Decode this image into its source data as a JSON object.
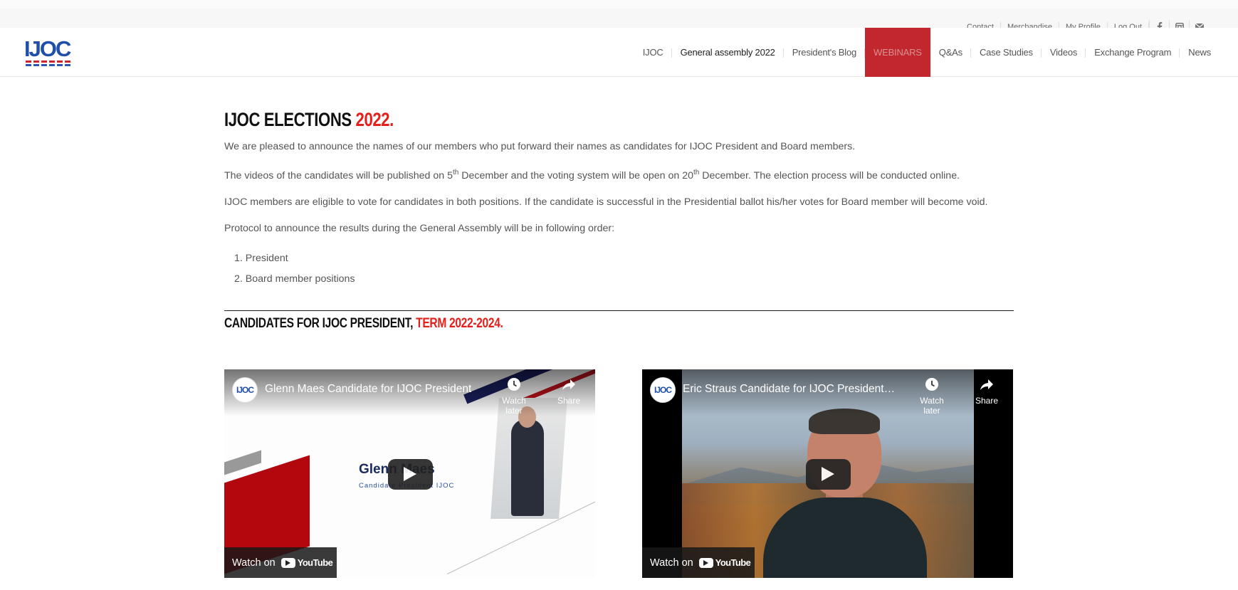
{
  "topbar": {
    "links": [
      "Contact",
      "Merchandise",
      "My Profile",
      "Log Out"
    ],
    "social_icons": [
      "facebook-icon",
      "instagram-icon",
      "mail-icon"
    ]
  },
  "header": {
    "logo_text": "IJOC",
    "nav": [
      "IJOC",
      "General assembly 2022",
      "President's Blog",
      "WEBINARS",
      "Q&As",
      "Case Studies",
      "Videos",
      "Exchange Program",
      "News"
    ],
    "active_color": "#c1272d"
  },
  "main": {
    "title_prefix": "IJOC ELECTIONS ",
    "title_accent": "2022.",
    "p1": "We are pleased to announce the names of our members who put forward their names as candidates for IJOC President and Board members.",
    "p2_a": "The videos of the candidates will be published on 5",
    "p2_sup1": "th",
    "p2_b": " December and the voting system will be open on 20",
    "p2_sup2": "th",
    "p2_c": " December. The election process will be conducted online.",
    "p3": "IJOC members are eligible to vote for candidates in both positions. If the candidate is successful in the Presidential ballot his/her votes for Board member will become void.",
    "p4": "Protocol to announce the results during the General Assembly will be in following order:",
    "order_list": [
      "1. President",
      "2. Board member positions"
    ],
    "subtitle_prefix": "CANDIDATES FOR IJOC PRESIDENT, ",
    "subtitle_accent": "TERM 2022-2024.",
    "accent_color": "#e3201b"
  },
  "videos": [
    {
      "title": "Glenn Maes Candidate for IJOC President",
      "channel_avatar": "IJOC",
      "watch_later": "Watch later",
      "share": "Share",
      "watch_on": "Watch on",
      "youtube": "YouTube",
      "thumb_name": "Glenn Maes",
      "thumb_sub": "Candidate President IJOC"
    },
    {
      "title": "Eric Straus Candidate for IJOC President…",
      "channel_avatar": "IJOC",
      "watch_later": "Watch later",
      "share": "Share",
      "watch_on": "Watch on",
      "youtube": "YouTube"
    }
  ]
}
